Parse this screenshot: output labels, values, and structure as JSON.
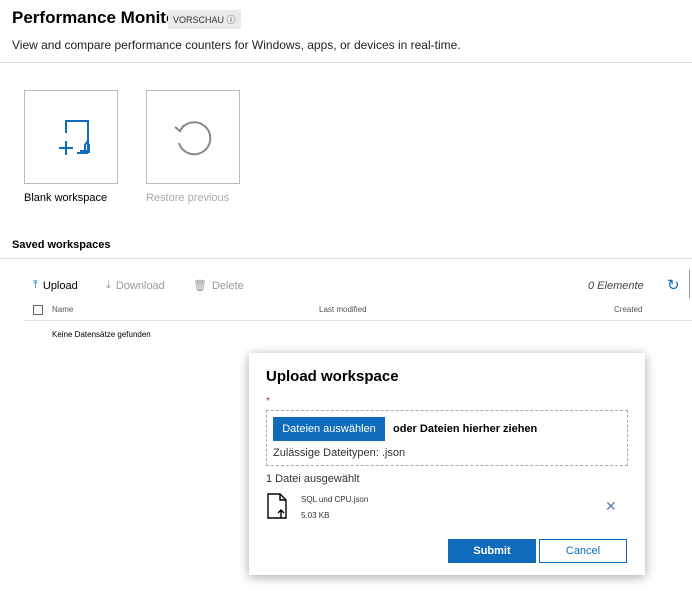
{
  "header": {
    "title": "Performance Monitor",
    "badge": "VORSCHAU ⓘ",
    "subtitle": "View and compare performance counters for Windows, apps, or devices in real-time."
  },
  "tiles": [
    {
      "label": "Blank workspace"
    },
    {
      "label": "Restore previous"
    }
  ],
  "saved": {
    "heading": "Saved workspaces",
    "toolbar": {
      "upload": "Upload",
      "download": "Download",
      "delete": "Delete",
      "count": "0 Elemente"
    },
    "columns": [
      "Name",
      "Last modified",
      "Created"
    ],
    "empty": "Keine Datensätze gefunden"
  },
  "dialog": {
    "title": "Upload workspace",
    "required": "*",
    "choose": "Dateien auswählen",
    "drag": "oder Dateien hierher ziehen",
    "types": "Zulässige Dateitypen: .json",
    "selected": "1 Datei ausgewählt",
    "file": {
      "name": "SQL und CPU.json",
      "size": "5.03 KB"
    },
    "submit": "Submit",
    "cancel": "Cancel"
  },
  "colors": {
    "accent": "#0f6cbd"
  }
}
